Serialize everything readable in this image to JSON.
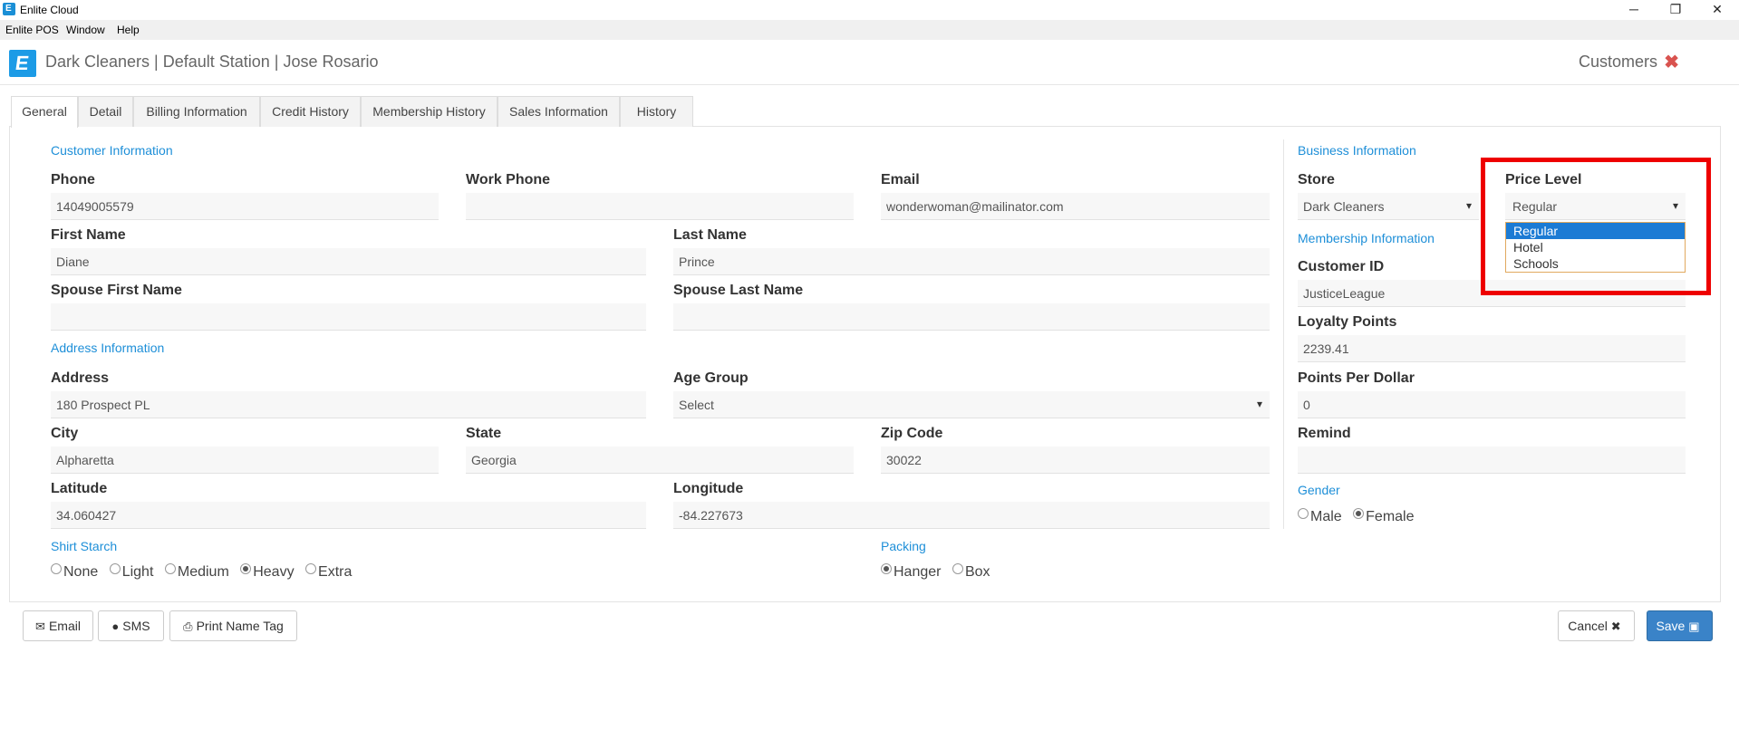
{
  "window": {
    "title": "Enlite Cloud",
    "minimize": "─",
    "restore": "❐",
    "close": "✕"
  },
  "menu": [
    "Enlite POS",
    "Window",
    "Help"
  ],
  "header": {
    "title": "Dark Cleaners | Default Station | Jose Rosario",
    "section": "Customers",
    "close": "✖"
  },
  "tabs": [
    "General",
    "Detail",
    "Billing Information",
    "Credit History",
    "Membership History",
    "Sales Information",
    "History"
  ],
  "customer": {
    "section": "Customer Information",
    "phone_label": "Phone",
    "phone": "14049005579",
    "work_phone_label": "Work Phone",
    "work_phone": "",
    "email_label": "Email",
    "email": "wonderwoman@mailinator.com",
    "first_name_label": "First Name",
    "first_name": "Diane",
    "last_name_label": "Last Name",
    "last_name": "Prince",
    "spouse_first_label": "Spouse First Name",
    "spouse_first": "",
    "spouse_last_label": "Spouse Last Name",
    "spouse_last": ""
  },
  "address": {
    "section": "Address Information",
    "address_label": "Address",
    "address": "180 Prospect PL",
    "age_group_label": "Age Group",
    "age_group": "Select",
    "city_label": "City",
    "city": "Alpharetta",
    "state_label": "State",
    "state": "Georgia",
    "zip_label": "Zip Code",
    "zip": "30022",
    "lat_label": "Latitude",
    "lat": "34.060427",
    "lng_label": "Longitude",
    "lng": "-84.227673"
  },
  "shirt_starch": {
    "section": "Shirt Starch",
    "options": [
      "None",
      "Light",
      "Medium",
      "Heavy",
      "Extra"
    ],
    "selected": "Heavy"
  },
  "packing": {
    "section": "Packing",
    "options": [
      "Hanger",
      "Box"
    ],
    "selected": "Hanger"
  },
  "business": {
    "section": "Business Information",
    "store_label": "Store",
    "store": "Dark Cleaners",
    "price_level_label": "Price Level",
    "price_level": "Regular",
    "price_level_options": [
      "Regular",
      "Hotel",
      "Schools"
    ]
  },
  "membership": {
    "section": "Membership Information",
    "customer_id_label": "Customer ID",
    "customer_id": "JusticeLeague",
    "loyalty_label": "Loyalty Points",
    "loyalty": "2239.41",
    "ppd_label": "Points Per Dollar",
    "ppd": "0",
    "remind_label": "Remind",
    "remind": ""
  },
  "gender": {
    "section": "Gender",
    "options": [
      "Male",
      "Female"
    ],
    "selected": "Female"
  },
  "footer": {
    "email": "Email",
    "sms": "SMS",
    "print": "Print Name Tag",
    "cancel": "Cancel",
    "save": "Save"
  }
}
